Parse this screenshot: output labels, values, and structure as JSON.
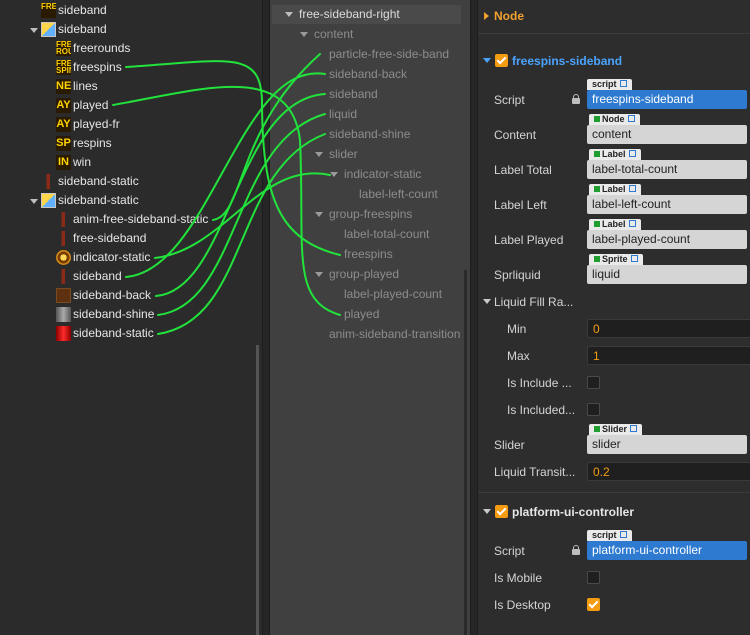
{
  "left_tree": [
    {
      "label": "sideband",
      "icon": "text-thumbnail-icon",
      "icon_text": "FREE"
    },
    {
      "label": "sideband",
      "icon": "node-icon"
    },
    {
      "label": "freerounds",
      "icon": "text-thumbnail-icon",
      "icon_text": "FREE ROUN"
    },
    {
      "label": "freespins",
      "icon": "text-thumbnail-icon",
      "icon_text": "FREE SPIN"
    },
    {
      "label": "lines",
      "icon": "text-thumbnail-icon",
      "icon_text": "NE"
    },
    {
      "label": "played",
      "icon": "text-thumbnail-icon",
      "icon_text": "AY"
    },
    {
      "label": "played-fr",
      "icon": "text-thumbnail-icon",
      "icon_text": "AY"
    },
    {
      "label": "respins",
      "icon": "text-thumbnail-icon",
      "icon_text": "SP"
    },
    {
      "label": "win",
      "icon": "text-thumbnail-icon",
      "icon_text": "IN"
    },
    {
      "label": "sideband-static",
      "icon": "bar-thumbnail-icon"
    },
    {
      "label": "sideband-static",
      "icon": "node-icon"
    },
    {
      "label": "anim-free-sideband-static",
      "icon": "bar-thumbnail-icon"
    },
    {
      "label": "free-sideband",
      "icon": "bar-thumbnail-icon"
    },
    {
      "label": "indicator-static",
      "icon": "dial-thumbnail-icon"
    },
    {
      "label": "sideband",
      "icon": "bar-thumbnail-icon"
    },
    {
      "label": "sideband-back",
      "icon": "brown-thumbnail-icon"
    },
    {
      "label": "sideband-shine",
      "icon": "gray-thumbnail-icon"
    },
    {
      "label": "sideband-static",
      "icon": "red-thumbnail-icon"
    }
  ],
  "mid_tree": [
    {
      "label": "free-sideband-right"
    },
    {
      "label": "content"
    },
    {
      "label": "particle-free-side-band"
    },
    {
      "label": "sideband-back"
    },
    {
      "label": "sideband"
    },
    {
      "label": "liquid"
    },
    {
      "label": "sideband-shine"
    },
    {
      "label": "slider"
    },
    {
      "label": "indicator-static"
    },
    {
      "label": "label-left-count"
    },
    {
      "label": "group-freespins"
    },
    {
      "label": "label-total-count"
    },
    {
      "label": "freespins"
    },
    {
      "label": "group-played"
    },
    {
      "label": "label-played-count"
    },
    {
      "label": "played"
    },
    {
      "label": "anim-sideband-transition"
    }
  ],
  "inspector": {
    "node_header": "Node",
    "comp1": {
      "title": "freespins-sideband",
      "enabled": true,
      "props": [
        {
          "label": "Script",
          "type_tag": "script",
          "value": "freespins-sideband"
        },
        {
          "label": "Content",
          "type_tag": "Node",
          "value": "content"
        },
        {
          "label": "Label Total",
          "type_tag": "Label",
          "value": "label-total-count"
        },
        {
          "label": "Label Left",
          "type_tag": "Label",
          "value": "label-left-count"
        },
        {
          "label": "Label Played",
          "type_tag": "Label",
          "value": "label-played-count"
        },
        {
          "label": "Sprliquid",
          "type_tag": "Sprite",
          "value": "liquid"
        }
      ],
      "liquid_group": "Liquid Fill Ra...",
      "min_label": "Min",
      "min_value": "0",
      "max_label": "Max",
      "max_value": "1",
      "include1_label": "Is Include ...",
      "include1_checked": false,
      "include2_label": "Is Included...",
      "include2_checked": false,
      "slider_label": "Slider",
      "slider_tag": "Slider",
      "slider_value": "slider",
      "transit_label": "Liquid Transit...",
      "transit_value": "0.2"
    },
    "comp2": {
      "title": "platform-ui-controller",
      "enabled": true,
      "script_label": "Script",
      "script_tag": "script",
      "script_value": "platform-ui-controller",
      "mobile_label": "Is Mobile",
      "mobile_checked": false,
      "desktop_label": "Is Desktop",
      "desktop_checked": true
    }
  },
  "colors": {
    "wire": "#22e23c",
    "accent": "#f39c12",
    "link": "#4aa4ff",
    "field_blue": "#2d7ad0"
  }
}
